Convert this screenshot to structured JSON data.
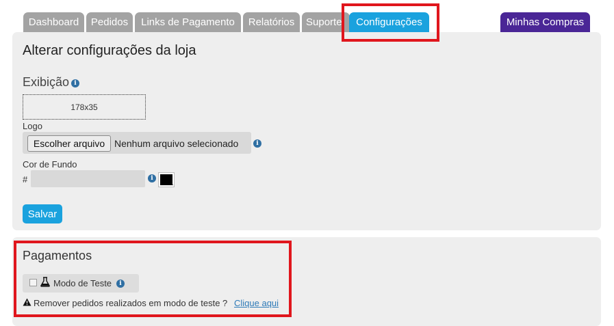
{
  "tabs": [
    {
      "label": "Dashboard"
    },
    {
      "label": "Pedidos"
    },
    {
      "label": "Links de Pagamento"
    },
    {
      "label": "Relatórios"
    },
    {
      "label": "Suporte"
    },
    {
      "label": "Configurações"
    }
  ],
  "active_tab": "Configurações",
  "my_purchases_label": "Minhas Compras",
  "store_settings": {
    "title": "Alterar configurações da loja",
    "display_heading": "Exibição",
    "logo_preview_text": "178x35",
    "logo_label": "Logo",
    "file_button_label": "Escolher arquivo",
    "file_status": "Nenhum arquivo selecionado",
    "bg_color_label": "Cor de Fundo",
    "hash_symbol": "#",
    "bg_color_value": "",
    "color_swatch": "#000000",
    "save_label": "Salvar"
  },
  "payments": {
    "heading": "Pagamentos",
    "test_mode_label": "Modo de Teste",
    "test_mode_checked": false,
    "remove_text": "Remover pedidos realizados em modo de teste ?",
    "remove_link": "Clique aqui"
  },
  "colors": {
    "tab_default": "#a3a3a3",
    "tab_active": "#1aa2de",
    "tab_purchases": "#4a2696",
    "highlight": "#e0161d",
    "panel_bg": "#eeeeee",
    "info_icon": "#2f6fa3"
  }
}
